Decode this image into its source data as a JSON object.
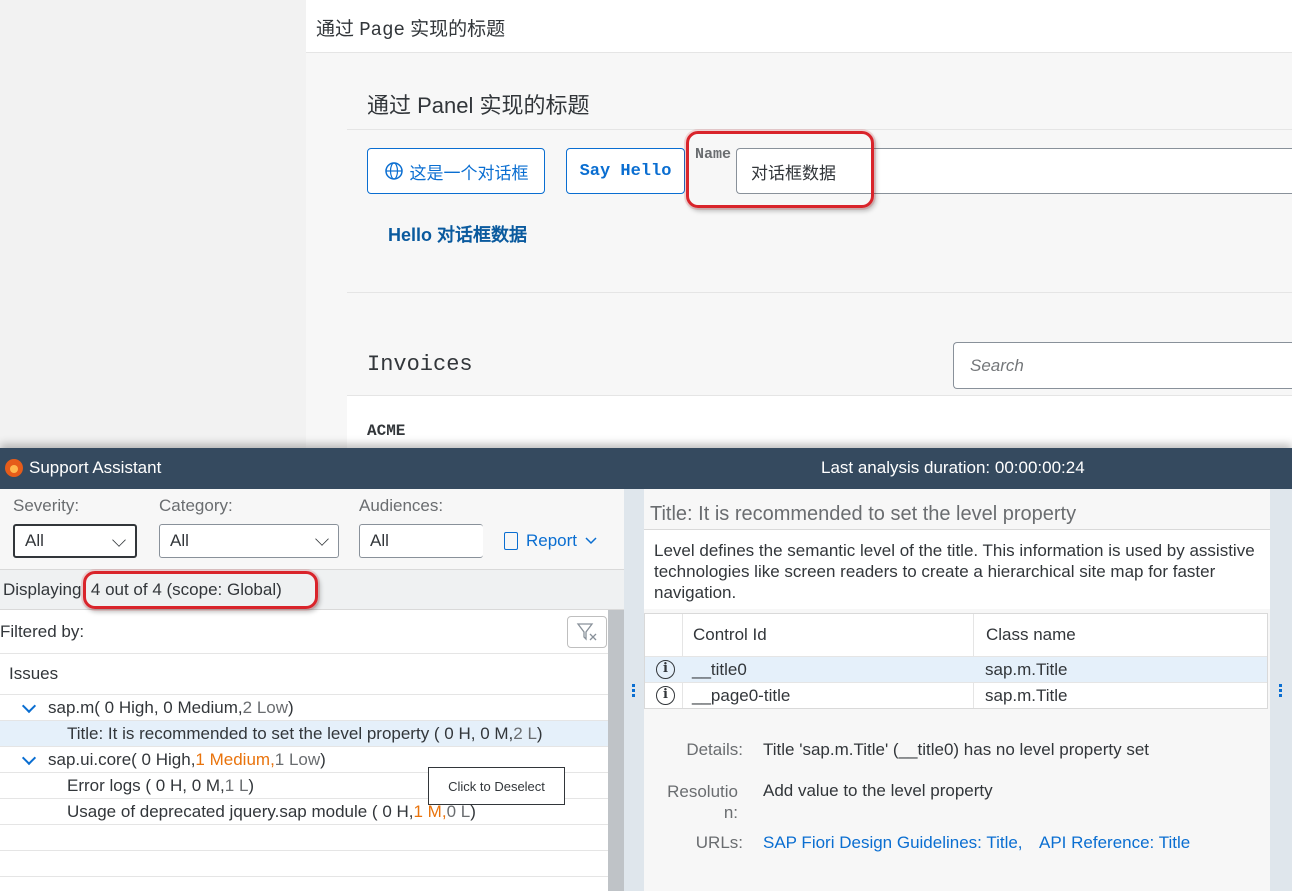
{
  "app": {
    "page_title_prefix": "通过 ",
    "page_title_mono": "Page",
    "page_title_suffix": " 实现的标题",
    "panel_title": "通过 Panel 实现的标题",
    "dialog_button": "这是一个对话框",
    "hello_button": "Say Hello",
    "name_label": "Name",
    "name_value": "对话框数据",
    "hello_text": "Hello 对话框数据",
    "invoices_title": "Invoices",
    "search_placeholder": "Search",
    "first_item": "ACME"
  },
  "support_assistant": {
    "title": "Support Assistant",
    "duration": "Last analysis duration: 00:00:00:24",
    "filters": {
      "severity_label": "Severity:",
      "severity_value": "All",
      "category_label": "Category:",
      "category_value": "All",
      "audiences_label": "Audiences:",
      "audiences_value": "All",
      "report_label": "Report"
    },
    "display_prefix": "Displaying",
    "display_value": "4 out of 4 (scope: Global)",
    "filtered_by": "Filtered by:",
    "issues_header": "Issues",
    "tree": [
      {
        "lib": "sap.m",
        "text_a": " ( 0 High, 0 Medium, ",
        "low": "2 Low",
        "text_b": " )"
      },
      {
        "item": "Title: It is recommended to set the level property ( 0 H, 0 M, ",
        "low": "2 L",
        "end": " )"
      },
      {
        "lib": "sap.ui.core",
        "text_a": " ( 0 High, ",
        "med": "1 Medium,",
        "low": " 1 Low",
        "text_b": " )"
      },
      {
        "item": "Error logs ( 0 H, 0 M, ",
        "low": "1 L",
        "end": " )"
      },
      {
        "item": "Usage of deprecated jquery.sap module ( 0 H, ",
        "med": "1 M,",
        "low": " 0 L",
        "end": " )"
      }
    ],
    "tooltip": "Click to Deselect",
    "detail": {
      "title": "Title: It is recommended to set the level property",
      "description": "Level defines the semantic level of the title. This information is used by assistive technologies like screen readers to create a hierarchical site map for faster navigation.",
      "col_control_id": "Control Id",
      "col_class_name": "Class name",
      "rows": [
        {
          "id": "__title0",
          "class": "sap.m.Title"
        },
        {
          "id": "__page0-title",
          "class": "sap.m.Title"
        }
      ],
      "details_label": "Details:",
      "details_value": "Title 'sap.m.Title' (__title0) has no level property set",
      "resolution_label_1": "Resolutio",
      "resolution_label_2": "n:",
      "resolution_value": "Add value to the level property",
      "urls_label": "URLs:",
      "url_1": "SAP Fiori Design Guidelines: Title,",
      "url_2": "API Reference: Title"
    }
  }
}
